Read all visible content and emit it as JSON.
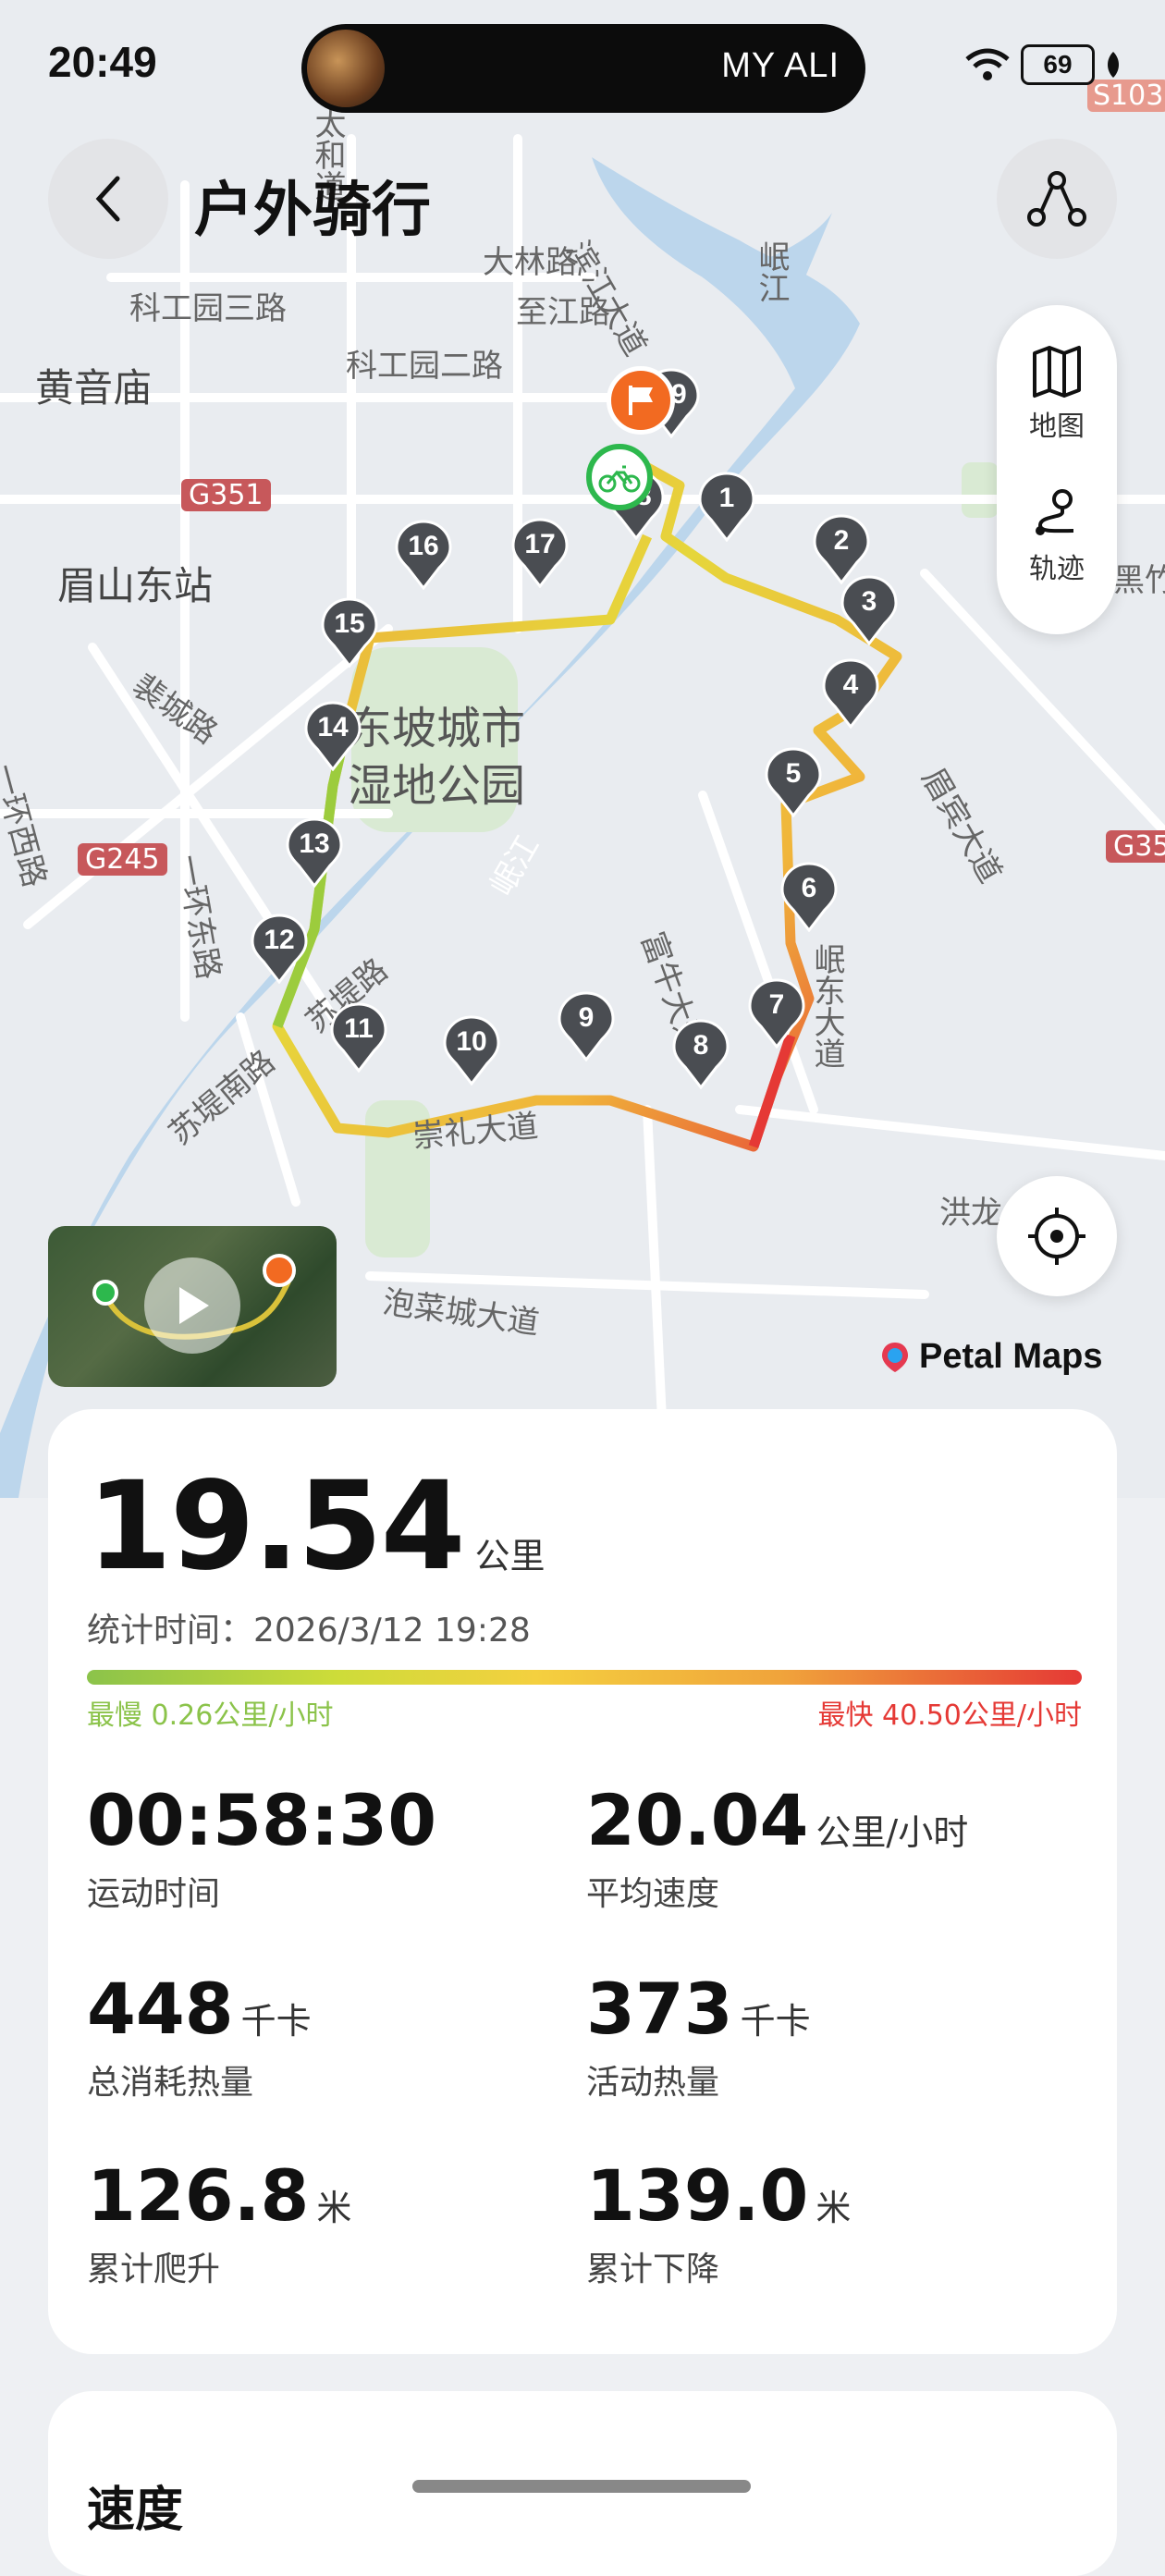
{
  "status": {
    "time": "20:49",
    "media_text": "MY ALI",
    "battery": "69"
  },
  "header": {
    "title": "户外骑行"
  },
  "layers": {
    "map_label": "地图",
    "track_label": "轨迹"
  },
  "map": {
    "brand": "Petal Maps",
    "labels": [
      "大林路",
      "科工园三路",
      "至江路",
      "科工园二路",
      "黄音庙",
      "G351",
      "眉山东站",
      "裴城路",
      "东坡城市",
      "湿地公园",
      "G245",
      "一环西路",
      "一环东路",
      "苏堤路",
      "苏堤南路",
      "岷江",
      "富牛大道",
      "泡菜城大道",
      "洪龙",
      "眉宾大道",
      "滨江大道",
      "G35",
      "S103",
      "太和道",
      "黑竹",
      "岷东大道",
      "岷江",
      "崇礼大道"
    ],
    "markers": [
      "1",
      "2",
      "3",
      "4",
      "5",
      "6",
      "7",
      "8",
      "9",
      "10",
      "11",
      "12",
      "13",
      "14",
      "15",
      "16",
      "17",
      "18",
      "19"
    ],
    "start_icon": "bicycle-icon",
    "end_icon": "flag-icon"
  },
  "summary": {
    "distance": "19.54",
    "distance_unit": "公里",
    "stat_time": "统计时间：2026/3/12 19:28",
    "slowest": "最慢 0.26公里/小时",
    "fastest": "最快 40.50公里/小时",
    "metrics": [
      {
        "value": "00:58:30",
        "unit": "",
        "label": "运动时间"
      },
      {
        "value": "20.04",
        "unit": "公里/小时",
        "label": "平均速度"
      },
      {
        "value": "448",
        "unit": "千卡",
        "label": "总消耗热量"
      },
      {
        "value": "373",
        "unit": "千卡",
        "label": "活动热量"
      },
      {
        "value": "126.8",
        "unit": "米",
        "label": "累计爬升"
      },
      {
        "value": "139.0",
        "unit": "米",
        "label": "累计下降"
      }
    ]
  },
  "section": {
    "title": "速度"
  },
  "colors": {
    "slow": "#8bc34a",
    "fast": "#e53935",
    "start": "#2db84d",
    "end": "#f26a21",
    "marker": "#4a4d52"
  }
}
